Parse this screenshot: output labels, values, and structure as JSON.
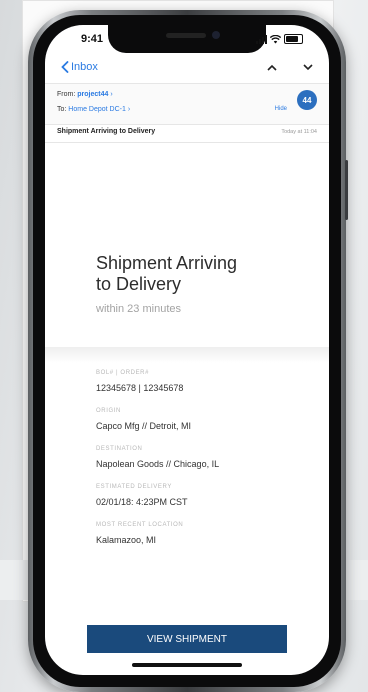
{
  "status": {
    "time": "9:41"
  },
  "nav": {
    "back_label": "Inbox"
  },
  "header": {
    "from_label": "From:",
    "from_name": "project44",
    "to_label": "To:",
    "to_name": "Home Depot DC-1",
    "hide_label": "Hide",
    "avatar_text": "44"
  },
  "subject": {
    "title": "Shipment Arriving to Delivery",
    "time": "Today at 11:04"
  },
  "hero": {
    "title_line1": "Shipment Arriving",
    "title_line2": "to Delivery",
    "subtitle": "within 23 minutes"
  },
  "fields": [
    {
      "label": "BOL# | ORDER#",
      "value": "12345678 | 12345678"
    },
    {
      "label": "ORIGIN",
      "value": "Capco Mfg // Detroit, MI"
    },
    {
      "label": "DESTINATION",
      "value": "Napolean Goods // Chicago, IL"
    },
    {
      "label": "ESTIMATED DELIVERY",
      "value": "02/01/18: 4:23PM CST"
    },
    {
      "label": "MOST RECENT LOCATION",
      "value": "Kalamazoo, MI"
    }
  ],
  "cta": {
    "label": "VIEW SHIPMENT"
  },
  "colors": {
    "accent": "#2a7ae2",
    "button": "#1a4a7c",
    "avatar": "#2c6fbf"
  }
}
